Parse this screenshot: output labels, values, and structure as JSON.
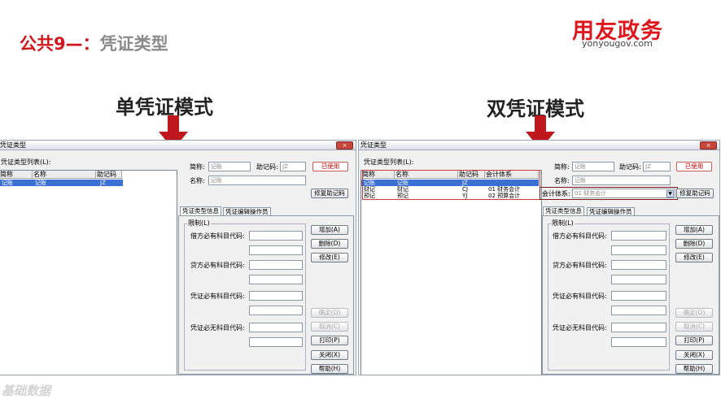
{
  "slide": {
    "title_prefix": "公共9—：",
    "title_main": "凭证类型",
    "brand_cn": "用友政务",
    "brand_en": "yonyougov.com",
    "label_single": "单凭证模式",
    "label_double": "双凭证模式",
    "footer": "基础数据",
    "accent_color": "#d4141b",
    "arrow_color": "#c0161d"
  },
  "window_single": {
    "title": "凭证类型",
    "close_label": "×",
    "list_label": "凭证类型列表(L):",
    "columns": [
      "简称",
      "名称",
      "助记码"
    ],
    "rows": [
      {
        "short": "记账",
        "name": "记账",
        "code": "JZ"
      }
    ],
    "fields": {
      "short_label": "简称:",
      "short_value": "记账",
      "code_label": "助记码:",
      "code_value": "JZ",
      "name_label": "名称:",
      "name_value": "记账"
    },
    "buttons": {
      "used": "已使用",
      "fix_code": "修复助记码",
      "add": "增加(A)",
      "delete": "删除(D)",
      "modify": "修改(E)",
      "confirm": "确定(O)",
      "cancel": "取消(C)",
      "print": "打印(P)",
      "close": "关闭(X)",
      "help": "帮助(H)"
    },
    "tabs": [
      "凭证类型信息",
      "凭证编辑操作员"
    ],
    "group_label": "限制(L)",
    "restrictions": [
      "借方必有科目代码:",
      "贷方必有科目代码:",
      "凭证必有科目代码:",
      "凭证必无科目代码:"
    ]
  },
  "window_double": {
    "title": "凭证类型",
    "close_label": "×",
    "list_label": "凭证类型列表(L):",
    "columns": [
      "简称",
      "名称",
      "助记码",
      "会计体系"
    ],
    "rows": [
      {
        "short": "记账",
        "name": "记账",
        "code": "JZ",
        "system": ""
      },
      {
        "short": "财记",
        "name": "财记",
        "code": "CJ",
        "system": "01 财务会计"
      },
      {
        "short": "预记",
        "name": "预记",
        "code": "YJ",
        "system": "02 预算会计"
      }
    ],
    "fields": {
      "short_label": "简称:",
      "short_value": "记账",
      "code_label": "助记码:",
      "code_value": "JZ",
      "name_label": "名称:",
      "name_value": "记账",
      "system_label": "会计体系:",
      "system_value": "01 财务会计"
    },
    "buttons": {
      "used": "已使用",
      "fix_code": "修复助记码",
      "add": "增加(A)",
      "delete": "删除(D)",
      "modify": "修改(E)",
      "confirm": "确定(O)",
      "cancel": "取消(C)",
      "print": "打印(P)",
      "close": "关闭(X)",
      "help": "帮助(H)"
    },
    "tabs": [
      "凭证类型信息",
      "凭证编辑操作员"
    ],
    "group_label": "限制(L)",
    "restrictions": [
      "借方必有科目代码:",
      "贷方必有科目代码:",
      "凭证必有科目代码:",
      "凭证必无科目代码:"
    ]
  }
}
